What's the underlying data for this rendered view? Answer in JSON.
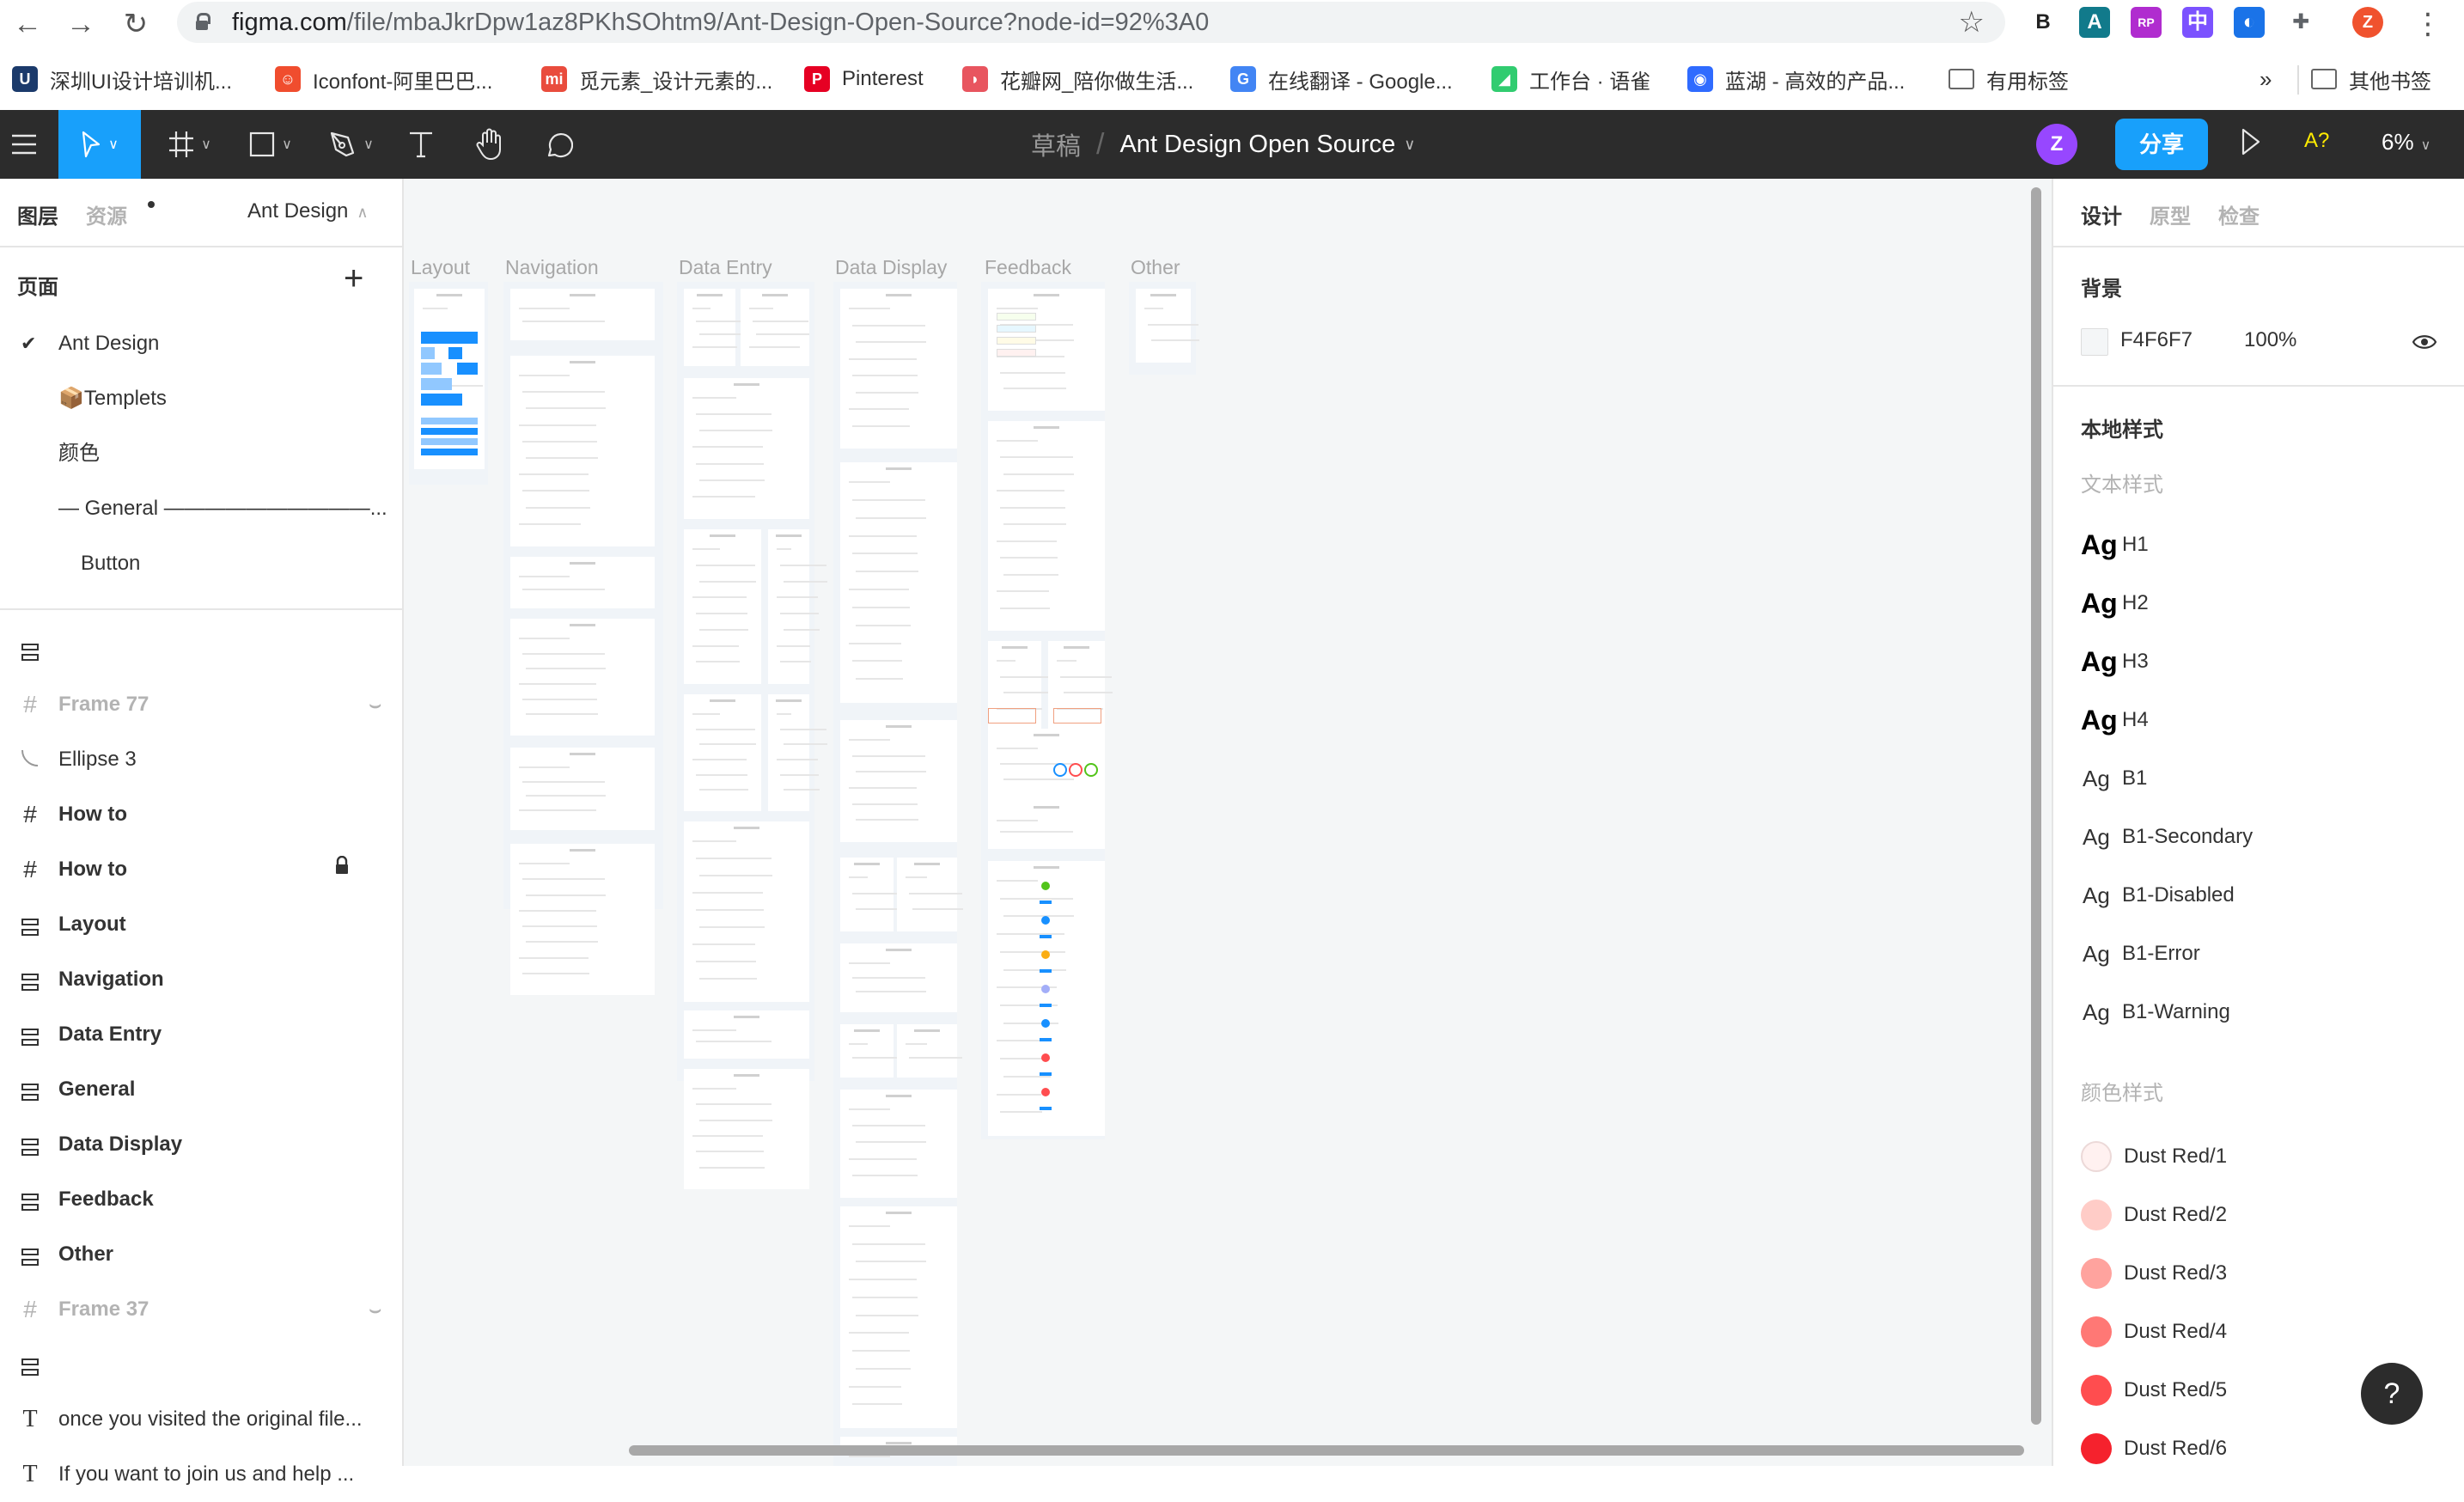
{
  "browser": {
    "url_host": "figma.com",
    "url_path": "/file/mbaJkrDpw1az8PKhSOhtm9/Ant-Design-Open-Source?node-id=92%3A0",
    "extensions": [
      {
        "name": "b-extension",
        "glyph": "B",
        "color": "#222222"
      },
      {
        "name": "a-extension",
        "glyph": "A",
        "color": "#117a8b"
      },
      {
        "name": "axure-rp-extension",
        "glyph": "RP",
        "color": "#b02ccf"
      },
      {
        "name": "translate-extension",
        "glyph": "中",
        "color": "#7b52ff"
      },
      {
        "name": "blue-bird-extension",
        "glyph": "◐",
        "color": "#1a73e8"
      },
      {
        "name": "puzzle-extension",
        "glyph": "✚",
        "color": "#5f6368"
      }
    ],
    "profile_initial": "Z",
    "profile_color": "#f0522e",
    "bookmarks": [
      {
        "label": "深圳UI设计培训机...",
        "icon": "ui-icon",
        "color": "#1b3a6b",
        "glyph": "U"
      },
      {
        "label": "Iconfont-阿里巴巴...",
        "icon": "iconfont-icon",
        "color": "#f04d2e",
        "glyph": "☺"
      },
      {
        "label": "觅元素_设计元素的...",
        "icon": "mi-icon",
        "color": "#e94c3d",
        "glyph": "mi"
      },
      {
        "label": "Pinterest",
        "icon": "pinterest-icon",
        "color": "#e60023",
        "glyph": "P"
      },
      {
        "label": "花瓣网_陪你做生活...",
        "icon": "huaban-icon",
        "color": "#e8555f",
        "glyph": "◗"
      },
      {
        "label": "在线翻译 - Google...",
        "icon": "google-icon",
        "color": "#4285f4",
        "glyph": "G"
      },
      {
        "label": "工作台 · 语雀",
        "icon": "yuque-icon",
        "color": "#31cc70",
        "glyph": "◢"
      },
      {
        "label": "蓝湖 - 高效的产品...",
        "icon": "lanhu-icon",
        "color": "#2f6bff",
        "glyph": "◉"
      },
      {
        "label": "有用标签",
        "icon": "folder-icon",
        "color": "#666666",
        "glyph": "▭"
      }
    ],
    "overflow_label": "»",
    "other_bookmarks": "其他书签"
  },
  "toolbar": {
    "project": "草稿",
    "file_name": "Ant Design Open Source",
    "avatar_initial": "Z",
    "share_label": "分享",
    "a11y_label": "A?",
    "zoom_level": "6%"
  },
  "left_panel": {
    "tab_layers": "图层",
    "tab_assets": "资源",
    "page_selector": "Ant Design",
    "pages_title": "页面",
    "pages": [
      {
        "label": "Ant Design",
        "current": true
      },
      {
        "label": "📦Templets",
        "current": false
      },
      {
        "label": "颜色",
        "current": false
      },
      {
        "label": "— General ——————————...",
        "current": false
      },
      {
        "label": "Button",
        "current": false,
        "indent": true
      }
    ],
    "layers": [
      {
        "label": "",
        "type": "autolayout",
        "state": "normal"
      },
      {
        "label": "Frame 77",
        "type": "frame",
        "state": "hidden"
      },
      {
        "label": "Ellipse 3",
        "type": "ellipse",
        "state": "normal"
      },
      {
        "label": "How to",
        "type": "frame",
        "state": "bold"
      },
      {
        "label": "How to",
        "type": "frame",
        "state": "locked"
      },
      {
        "label": "Layout",
        "type": "autolayout",
        "state": "bold"
      },
      {
        "label": "Navigation",
        "type": "autolayout",
        "state": "bold"
      },
      {
        "label": "Data Entry",
        "type": "autolayout",
        "state": "bold"
      },
      {
        "label": "General",
        "type": "autolayout",
        "state": "bold"
      },
      {
        "label": "Data Display",
        "type": "autolayout",
        "state": "bold"
      },
      {
        "label": "Feedback",
        "type": "autolayout",
        "state": "bold"
      },
      {
        "label": "Other",
        "type": "autolayout",
        "state": "bold"
      },
      {
        "label": "Frame 37",
        "type": "frame",
        "state": "hidden"
      },
      {
        "label": "",
        "type": "autolayout",
        "state": "normal"
      },
      {
        "label": "once you visited the original file...",
        "type": "text",
        "state": "normal"
      },
      {
        "label": "If you want to join us and help ...",
        "type": "text",
        "state": "normal"
      }
    ]
  },
  "canvas": {
    "background": "#F4F6F7",
    "sections": [
      {
        "label": "Layout"
      },
      {
        "label": "Navigation"
      },
      {
        "label": "Data Entry"
      },
      {
        "label": "Data Display"
      },
      {
        "label": "Feedback"
      },
      {
        "label": "Other"
      }
    ]
  },
  "right_panel": {
    "tab_design": "设计",
    "tab_prototype": "原型",
    "tab_inspect": "检查",
    "background_title": "背景",
    "background_hex": "F4F6F7",
    "background_opacity": "100%",
    "local_styles_title": "本地样式",
    "text_styles_title": "文本样式",
    "text_styles": [
      {
        "sample": "Ag",
        "name": "H1",
        "weight": "bold"
      },
      {
        "sample": "Ag",
        "name": "H2",
        "weight": "bold"
      },
      {
        "sample": "Ag",
        "name": "H3",
        "weight": "bold"
      },
      {
        "sample": "Ag",
        "name": "H4",
        "weight": "bold"
      },
      {
        "sample": "Ag",
        "name": "B1",
        "weight": "normal"
      },
      {
        "sample": "Ag",
        "name": "B1-Secondary",
        "weight": "normal"
      },
      {
        "sample": "Ag",
        "name": "B1-Disabled",
        "weight": "normal"
      },
      {
        "sample": "Ag",
        "name": "B1-Error",
        "weight": "normal"
      },
      {
        "sample": "Ag",
        "name": "B1-Warning",
        "weight": "normal"
      }
    ],
    "color_styles_title": "颜色样式",
    "color_styles": [
      {
        "name": "Dust Red/1",
        "color": "#fff1f0"
      },
      {
        "name": "Dust Red/2",
        "color": "#ffccc7"
      },
      {
        "name": "Dust Red/3",
        "color": "#ffa39e"
      },
      {
        "name": "Dust Red/4",
        "color": "#ff7875"
      },
      {
        "name": "Dust Red/5",
        "color": "#ff4d4f"
      },
      {
        "name": "Dust Red/6",
        "color": "#f5222d"
      }
    ],
    "help_label": "?"
  },
  "colors": {
    "accent": "#18a0fb",
    "toolbar_bg": "#2c2c2c",
    "ant_blue": "#1890ff"
  }
}
